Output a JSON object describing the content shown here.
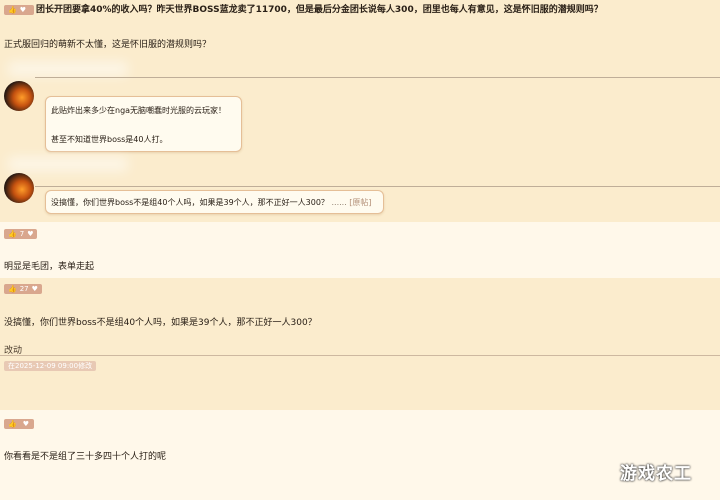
{
  "thread": {
    "title": "团长开团要拿40%的收入吗？昨天世界BOSS蓝龙卖了11700，但是最后分金团长说每人300，团里也每人有意见，这是怀旧服的潜规则吗？",
    "body": "正式服回归的萌新不太懂，这是怀旧服的潜规则吗？"
  },
  "comments": [
    {
      "quote_lines": [
        "此贴炸出来多少在nga无脑嘲蠢时光服的云玩家！",
        "甚至不知道世界boss是40人打。"
      ]
    },
    {
      "quote_text": "没搞懂，你们世界boss不是组40个人吗，如果是39个人，那不正好一人300？",
      "quote_ellipsis": "......",
      "quote_link": "[原帖]"
    }
  ],
  "replies": [
    {
      "likes": "7",
      "text": "明显是毛团，表单走起"
    },
    {
      "likes": "27",
      "text": "没搞懂，你们世界boss不是组40个人吗，如果是39个人，那不正好一人300？",
      "edit_label": "改动",
      "edit_badge": "在2025-12-09 09:00修改"
    },
    {
      "likes": "",
      "text": "你看看是不是组了三十多四十个人打的呢"
    }
  ],
  "watermark": "游戏农工",
  "colors": {
    "background": "#fbeccd",
    "badge": "#d9a78e",
    "quote_border": "#e5bf97",
    "reply_bg": "#fff8ea"
  }
}
